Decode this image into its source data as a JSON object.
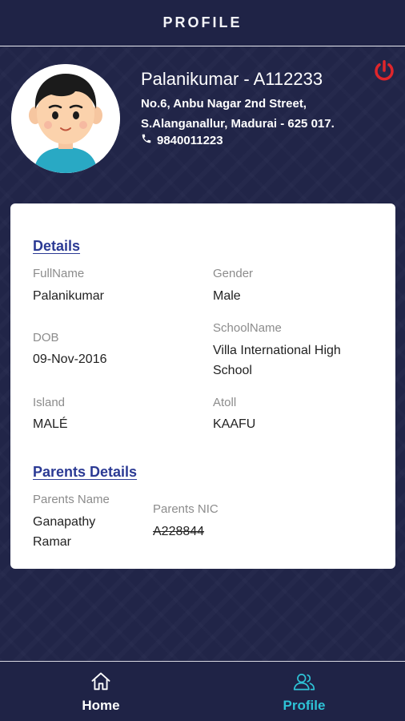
{
  "header": {
    "title": "PROFILE"
  },
  "profile": {
    "name": "Palanikumar - A112233",
    "address": "No.6, Anbu Nagar 2nd Street, S.Alanganallur, Madurai - 625 017.",
    "phone": "9840011223"
  },
  "details": {
    "title": "Details",
    "fullname_label": "FullName",
    "fullname_value": "Palanikumar",
    "gender_label": "Gender",
    "gender_value": "Male",
    "dob_label": "DOB",
    "dob_value": "09-Nov-2016",
    "school_label": "SchoolName",
    "school_value": "Villa International High School",
    "island_label": "Island",
    "island_value": "MALÉ",
    "atoll_label": "Atoll",
    "atoll_value": "KAAFU"
  },
  "parents": {
    "title": "Parents Details",
    "name_label": "Parents Name",
    "name_value": "Ganapathy Ramar",
    "nic_label": "Parents NIC",
    "nic_value": "A228844"
  },
  "nav": {
    "home_label": "Home",
    "profile_label": "Profile",
    "active_color": "#2ec3d6"
  },
  "icons": {
    "power": "power-icon",
    "phone": "phone-icon",
    "home": "home-icon",
    "profile": "users-icon"
  },
  "colors": {
    "background": "#212548",
    "link": "#2b3a94",
    "power": "#e0262b"
  }
}
